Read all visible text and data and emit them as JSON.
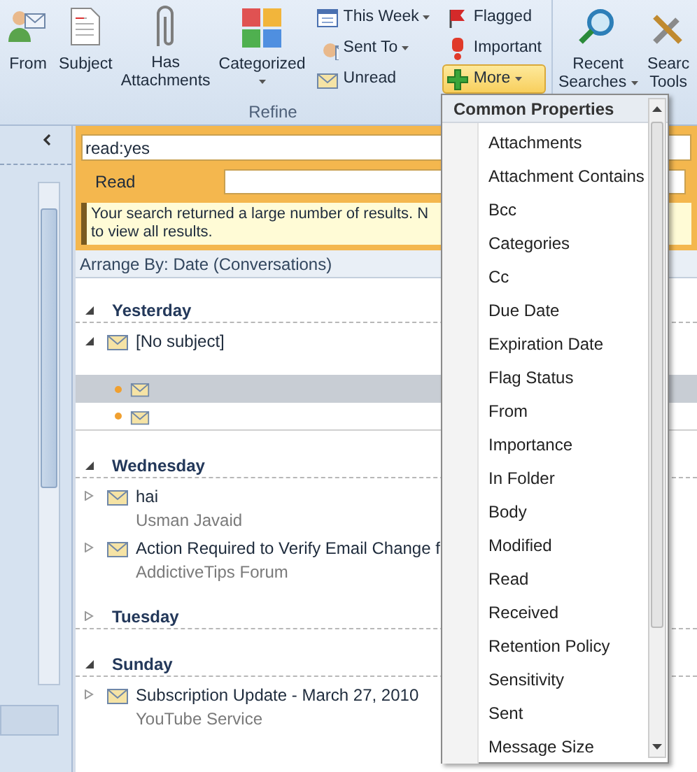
{
  "ribbon": {
    "large_buttons": [
      {
        "lines": [
          "From"
        ],
        "kind": "person",
        "dropdown": false
      },
      {
        "lines": [
          "Subject"
        ],
        "kind": "document",
        "dropdown": false
      },
      {
        "lines": [
          "Has",
          "Attachments"
        ],
        "kind": "paperclip",
        "dropdown": false
      },
      {
        "lines": [
          "Categorized"
        ],
        "kind": "categories",
        "dropdown": true
      }
    ],
    "small_columns": [
      [
        {
          "label": "This Week",
          "kind": "calendar",
          "dropdown": true,
          "selected": false
        },
        {
          "label": "Sent To",
          "kind": "person",
          "dropdown": true,
          "selected": false
        },
        {
          "label": "Unread",
          "kind": "envelope",
          "dropdown": false,
          "selected": false
        }
      ],
      [
        {
          "label": "Flagged",
          "kind": "flag",
          "dropdown": false,
          "selected": false
        },
        {
          "label": "Important",
          "kind": "exclamation",
          "dropdown": false,
          "selected": false
        },
        {
          "label": "More",
          "kind": "plus",
          "dropdown": true,
          "selected": true
        }
      ]
    ],
    "group_label": "Refine",
    "search_buttons": [
      {
        "lines": [
          "Recent",
          "Searches"
        ],
        "kind": "magnifier",
        "dropdown": true
      },
      {
        "lines": [
          "Searc",
          "Tools"
        ],
        "kind": "tools",
        "dropdown": false
      }
    ]
  },
  "search": {
    "query": "read:yes",
    "criteria_label": "Read",
    "message_lines": [
      "Your search returned a large number of results. N",
      "to view all results."
    ]
  },
  "arrange_by": "Arrange By: Date (Conversations)",
  "groups": [
    {
      "label": "Yesterday",
      "expanded": true,
      "items": [
        {
          "subject": "[No subject]",
          "expanded": true,
          "children": [
            {
              "selected": true
            },
            {
              "selected": false
            }
          ]
        }
      ]
    },
    {
      "label": "Wednesday",
      "expanded": true,
      "items": [
        {
          "subject": "hai",
          "sender": "Usman Javaid",
          "expanded": false
        },
        {
          "subject": "Action Required to Verify Email Change f",
          "sender": "AddictiveTips Forum",
          "expanded": false
        }
      ]
    },
    {
      "label": "Tuesday",
      "expanded": false
    },
    {
      "label": "Sunday",
      "expanded": true,
      "items": [
        {
          "subject": "Subscription Update - March 27, 2010",
          "sender": "YouTube Service",
          "expanded": false
        }
      ]
    }
  ],
  "menu": {
    "header": "Common Properties",
    "items": [
      "Attachments",
      "Attachment Contains",
      "Bcc",
      "Categories",
      "Cc",
      "Due Date",
      "Expiration Date",
      "Flag Status",
      "From",
      "Importance",
      "In Folder",
      "Body",
      "Modified",
      "Read",
      "Received",
      "Retention Policy",
      "Sensitivity",
      "Sent",
      "Message Size"
    ]
  }
}
